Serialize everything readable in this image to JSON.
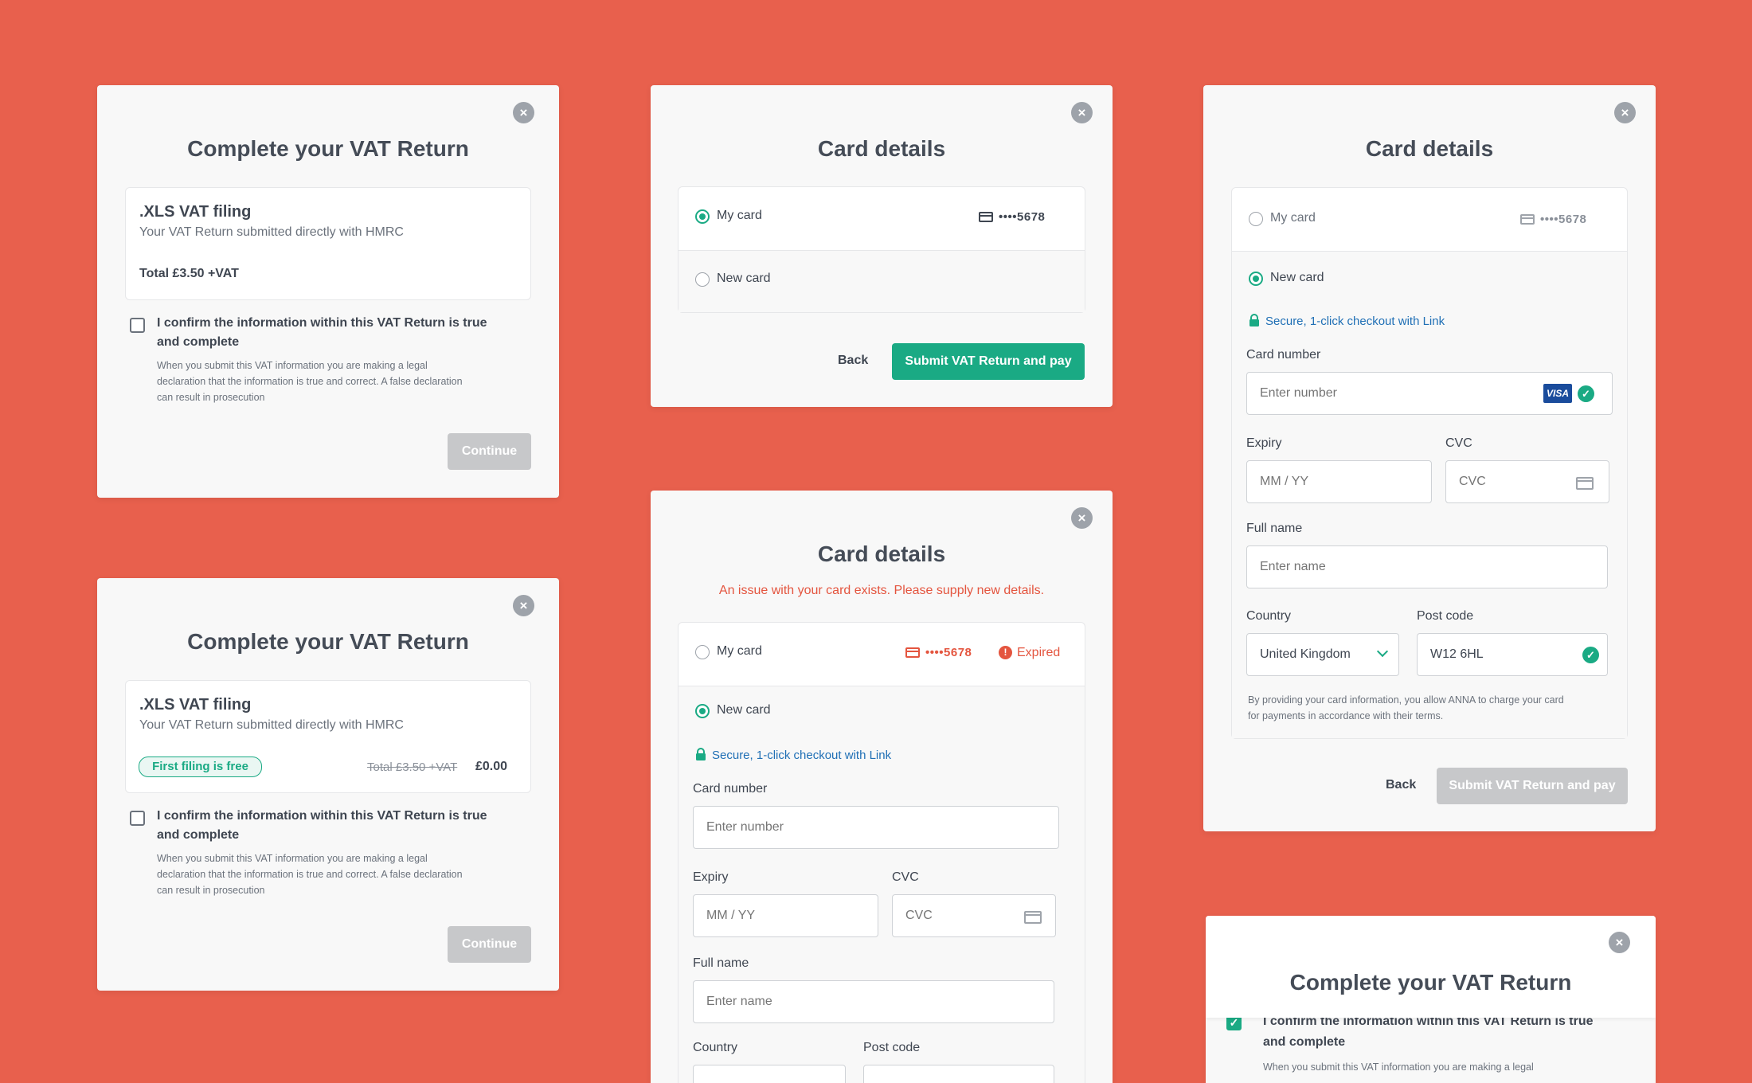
{
  "colors": {
    "background": "#e8604d",
    "accent": "#1aaa84",
    "error": "#e4553f",
    "link": "#1f6fb5",
    "disabled": "#c7c8ca"
  },
  "modal_vat_1": {
    "title": "Complete your VAT Return",
    "plan_title": ".XLS VAT filing",
    "plan_subtitle": "Your VAT Return submitted directly with HMRC",
    "total": "Total £3.50 +VAT",
    "confirm_line1": "I confirm the information within this VAT Return is true",
    "confirm_line2": "and complete",
    "legal_line1": "When you submit this VAT information you are making a legal",
    "legal_line2": "declaration that the information is true and correct. A false declaration",
    "legal_line3": "can result in prosecution",
    "continue_label": "Continue",
    "close_icon": "×"
  },
  "modal_vat_2": {
    "title": "Complete your VAT Return",
    "plan_title": ".XLS VAT filing",
    "plan_subtitle": "Your VAT Return submitted directly with HMRC",
    "badge": "First filing is free",
    "old_price": "Total £3.50 +VAT",
    "new_price": "£0.00",
    "confirm_line1": "I confirm the information within this VAT Return is true",
    "confirm_line2": "and complete",
    "legal_line1": "When you submit this VAT information you are making a legal",
    "legal_line2": "declaration that the information is true and correct. A false declaration",
    "legal_line3": "can result in prosecution",
    "continue_label": "Continue",
    "close_icon": "×"
  },
  "modal_card_saved": {
    "title": "Card details",
    "my_card_label": "My card",
    "card_number": "••••5678",
    "new_card_label": "New card",
    "back_label": "Back",
    "submit_label": "Submit VAT Return and pay",
    "close_icon": "×"
  },
  "modal_card_expired": {
    "title": "Card details",
    "error": "An issue with your card exists. Please supply new details.",
    "my_card_label": "My card",
    "card_number": "••••5678",
    "expired_label": "Expired",
    "new_card_label": "New card",
    "secure_link": "Secure, 1-click checkout with Link",
    "card_number_label": "Card number",
    "card_number_placeholder": "Enter number",
    "expiry_label": "Expiry",
    "expiry_placeholder": "MM / YY",
    "cvc_label": "CVC",
    "cvc_placeholder": "CVC",
    "full_name_label": "Full name",
    "full_name_placeholder": "Enter name",
    "country_label": "Country",
    "postcode_label": "Post code",
    "close_icon": "×"
  },
  "modal_card_new": {
    "title": "Card details",
    "my_card_label": "My card",
    "card_number": "••••5678",
    "new_card_label": "New card",
    "secure_link": "Secure, 1-click checkout with Link",
    "card_number_label": "Card number",
    "card_number_placeholder": "Enter number",
    "card_brand": "VISA",
    "expiry_label": "Expiry",
    "expiry_placeholder": "MM / YY",
    "cvc_label": "CVC",
    "cvc_placeholder": "CVC",
    "full_name_label": "Full name",
    "full_name_placeholder": "Enter name",
    "country_label": "Country",
    "country_value": "United Kingdom",
    "postcode_label": "Post code",
    "postcode_value": "W12 6HL",
    "consent_line1": "By providing your card information, you allow ANNA to charge your card",
    "consent_line2": "for payments in accordance with their terms.",
    "back_label": "Back",
    "submit_label": "Submit VAT Return and pay",
    "close_icon": "×"
  },
  "modal_vat_3": {
    "title": "Complete your VAT Return",
    "confirm_line1": "I confirm the information within this VAT Return is true",
    "confirm_line2": "and complete",
    "legal_line1": "When you submit this VAT information you are making a legal",
    "close_icon": "×",
    "check_glyph": "✓"
  }
}
